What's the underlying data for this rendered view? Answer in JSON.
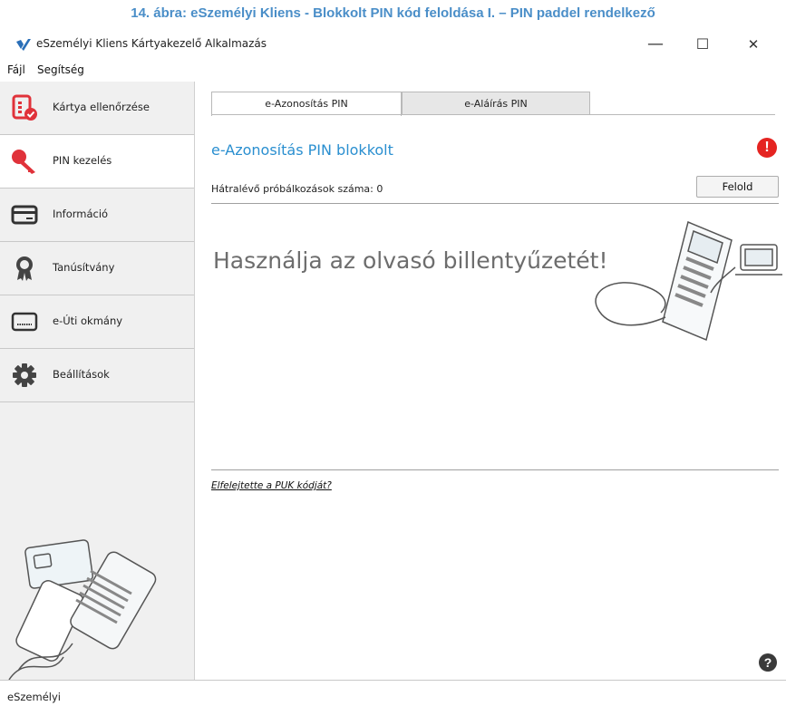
{
  "figure_caption": "14. ábra: eSzemélyi Kliens - Blokkolt PIN kód feloldása I. – PIN paddel rendelkező",
  "window": {
    "title": "eSzemélyi Kliens Kártyakezelő Alkalmazás",
    "minimize_glyph": "—",
    "maximize_glyph": "☐",
    "close_glyph": "✕"
  },
  "menu": {
    "items": [
      {
        "label": "Fájl"
      },
      {
        "label": "Segítség"
      }
    ]
  },
  "sidebar": {
    "items": [
      {
        "label": "Kártya ellenőrzése",
        "icon": "card-check-icon"
      },
      {
        "label": "PIN kezelés",
        "icon": "key-icon",
        "active": true
      },
      {
        "label": "Információ",
        "icon": "card-icon"
      },
      {
        "label": "Tanúsítvány",
        "icon": "certificate-icon"
      },
      {
        "label": "e-Úti okmány",
        "icon": "passport-card-icon"
      },
      {
        "label": "Beállítások",
        "icon": "gear-icon"
      }
    ]
  },
  "main": {
    "tabs": [
      {
        "label": "e-Azonosítás PIN",
        "active": true
      },
      {
        "label": "e-Aláírás PIN",
        "active": false
      }
    ],
    "blocked_title": "e-Azonosítás PIN blokkolt",
    "alert_glyph": "!",
    "attempts_text": "Hátralévő próbálkozások száma: 0",
    "unlock_button": "Felold",
    "hint": "Használja az olvasó billentyűzetét!",
    "puk_link": "Elfelejtette a PUK kódját?",
    "help_glyph": "?"
  },
  "status": {
    "text": "eSzemélyi"
  },
  "colors": {
    "accent": "#2a8fd0",
    "caption": "#4a8ec8",
    "alert": "#e52421",
    "icon_red": "#e0323a"
  }
}
